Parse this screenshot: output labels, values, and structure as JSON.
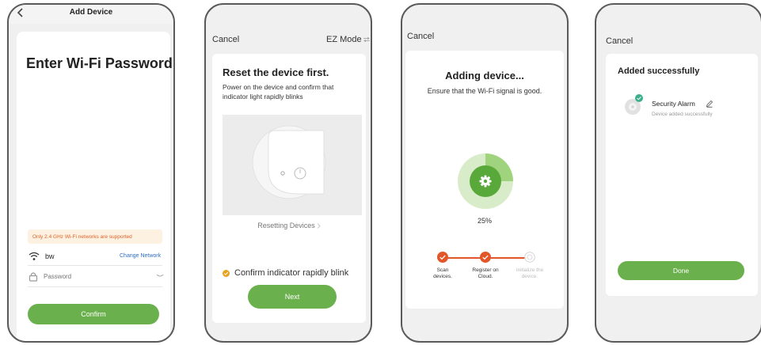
{
  "colors": {
    "accent": "#6ab04c",
    "step_done": "#e2562a",
    "warning_text": "#e0612a"
  },
  "screen1": {
    "back_icon": "chevron-left-icon",
    "header_title": "Add Device",
    "heading": "Enter Wi-Fi Password",
    "warning": "Only 2.4 GHz Wi-Fi networks are supported",
    "wifi_icon": "wifi-icon",
    "network_name": "bw",
    "change_network": "Change Network",
    "lock_icon": "lock-icon",
    "password_placeholder": "Password",
    "eye_icon": "eye-closed-icon",
    "confirm_label": "Confirm"
  },
  "screen2": {
    "cancel_label": "Cancel",
    "mode_label": "EZ Mode",
    "mode_switch_icon": "switch-arrows-icon",
    "heading": "Reset the device first.",
    "instruction": "Power on the device and confirm that indicator light rapidly blinks",
    "resetting_link": "Resetting Devices",
    "chevron_icon": "chevron-right-icon",
    "confirm_check": "Confirm indicator rapidly blink",
    "next_label": "Next"
  },
  "screen3": {
    "cancel_label": "Cancel",
    "heading": "Adding device...",
    "subtext": "Ensure that the Wi-Fi signal is good.",
    "gear_icon": "gear-icon",
    "progress_text": "25%",
    "progress_fraction": 0.25,
    "steps": [
      {
        "label": "Scan devices.",
        "state": "done"
      },
      {
        "label": "Register on Cloud.",
        "state": "done"
      },
      {
        "label": "Initialize the device.",
        "state": "pending"
      }
    ]
  },
  "screen4": {
    "cancel_label": "Cancel",
    "heading": "Added successfully",
    "device_name": "Security Alarm",
    "edit_icon": "pencil-icon",
    "device_status": "Device added successfully",
    "done_label": "Done"
  }
}
